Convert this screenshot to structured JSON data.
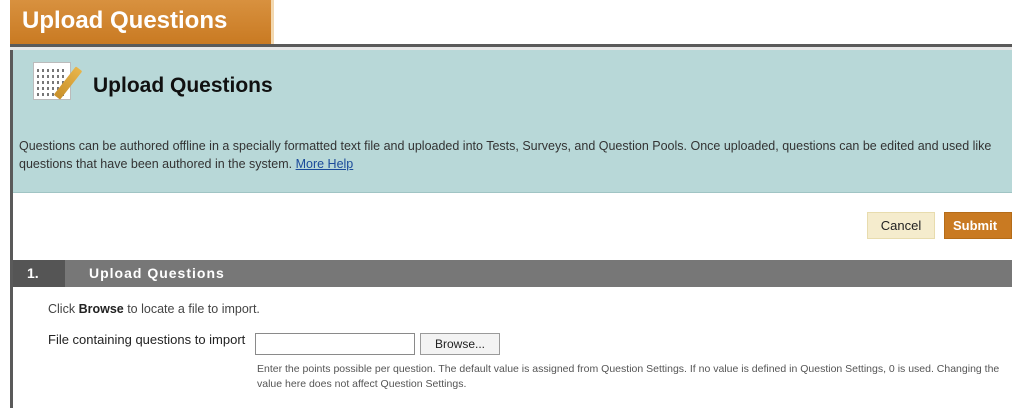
{
  "page": {
    "title_tab": "Upload Questions"
  },
  "header": {
    "icon": "test-questions-icon",
    "title": "Upload Questions",
    "description": "Questions can be authored offline in a specially formatted text file and uploaded into Tests, Surveys, and Question Pools. Once uploaded, questions can be edited and used like questions that have been authored in the system.",
    "help_link": "More Help"
  },
  "actions": {
    "cancel": "Cancel",
    "submit": "Submit"
  },
  "step": {
    "number": "1.",
    "title": "Upload Questions",
    "instructions_prefix": "Click ",
    "instructions_bold": "Browse",
    "instructions_suffix": " to locate a file to import.",
    "field_label": "File containing questions to import",
    "file_value": "",
    "browse_label": "Browse...",
    "help_text": "Enter the points possible per question. The default value is assigned from Question Settings. If no value is defined in Question Settings, 0 is used. Changing the value here does not affect Question Settings."
  },
  "colors": {
    "accent": "#c97a22",
    "header_bg": "#b8d8d8",
    "step_bar": "#777777"
  }
}
